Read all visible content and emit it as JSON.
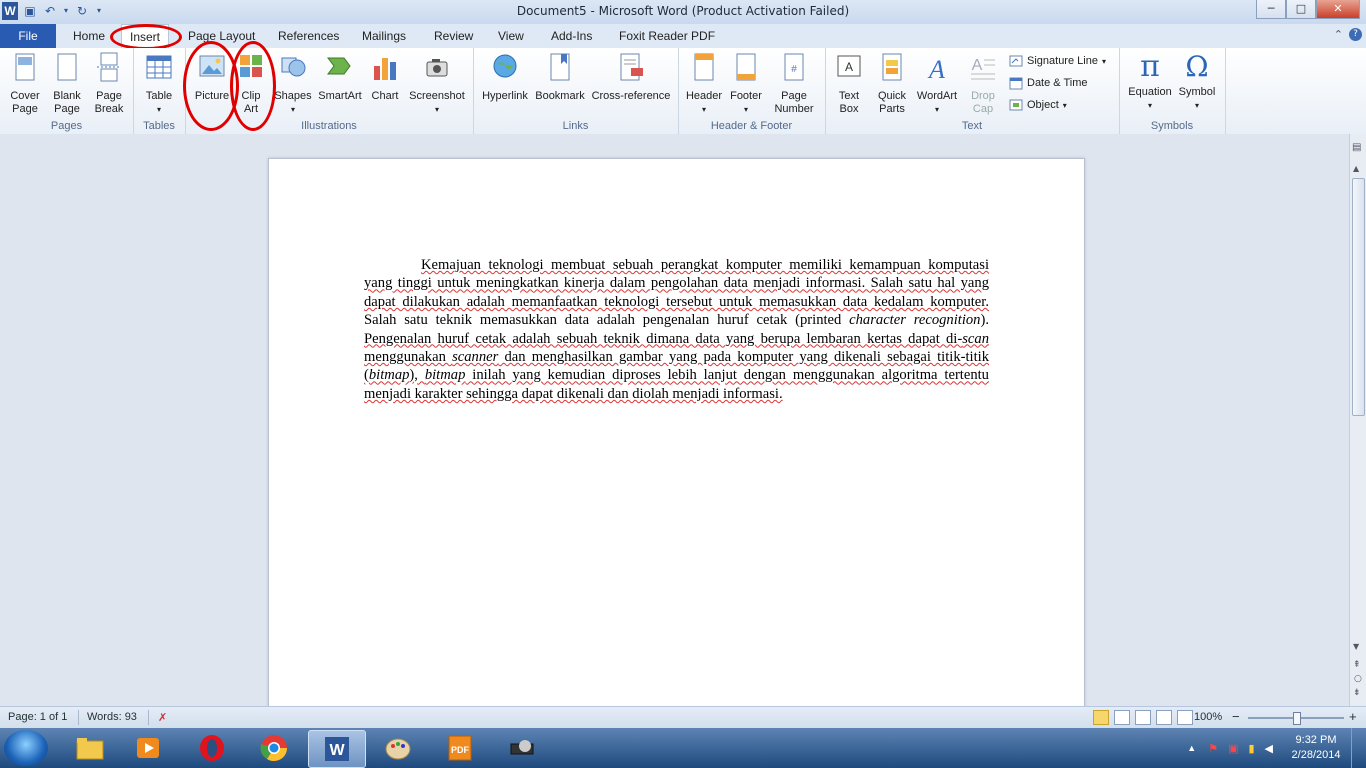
{
  "window": {
    "title": "Document5  -  Microsoft Word (Product Activation Failed)",
    "controls": {
      "minimize": "─",
      "maximize": "□",
      "close": "✕"
    }
  },
  "tabs": {
    "file": "File",
    "items": [
      "Home",
      "Insert",
      "Page Layout",
      "References",
      "Mailings",
      "Review",
      "View",
      "Add-Ins",
      "Foxit Reader PDF"
    ],
    "active": "Insert"
  },
  "ribbon": {
    "groups": {
      "pages": "Pages",
      "tables": "Tables",
      "illustrations": "Illustrations",
      "links": "Links",
      "header_footer": "Header & Footer",
      "text": "Text",
      "symbols": "Symbols"
    },
    "buttons": {
      "cover_page": [
        "Cover",
        "Page"
      ],
      "blank_page": [
        "Blank",
        "Page"
      ],
      "page_break": [
        "Page",
        "Break"
      ],
      "table": "Table",
      "picture": "Picture",
      "clip_art": [
        "Clip",
        "Art"
      ],
      "shapes": "Shapes",
      "smartart": "SmartArt",
      "chart": "Chart",
      "screenshot": "Screenshot",
      "hyperlink": "Hyperlink",
      "bookmark": "Bookmark",
      "cross_reference": "Cross-reference",
      "header": "Header",
      "footer": "Footer",
      "page_number": [
        "Page",
        "Number"
      ],
      "text_box": [
        "Text",
        "Box"
      ],
      "quick_parts": [
        "Quick",
        "Parts"
      ],
      "wordart": "WordArt",
      "drop_cap": [
        "Drop",
        "Cap"
      ],
      "signature_line": "Signature Line",
      "date_time": "Date & Time",
      "object": "Object",
      "equation": "Equation",
      "symbol": "Symbol"
    },
    "symbol_glyphs": {
      "equation": "π",
      "symbol": "Ω"
    }
  },
  "document": {
    "paragraph_runs": [
      {
        "t": "Kemajuan teknologi membuat sebuah perangkat komputer memiliki kemampuan komputasi yang tinggi untuk meningkatkan kinerja dalam pengolahan data menjadi informasi. Salah satu hal yang dapat dilakukan adalah memanfaatkan teknologi tersebut untuk memasukkan data kedalam komputer.",
        "s": "u"
      },
      {
        "t": " Salah satu teknik memasukkan data adalah pengenalan huruf cetak (printed ",
        "s": ""
      },
      {
        "t": "character recognition",
        "s": "i"
      },
      {
        "t": ").",
        "s": ""
      },
      {
        "t": " Pengenalan huruf cetak adalah sebuah teknik dimana data yang berupa lembaran kertas dapat di-",
        "s": "u"
      },
      {
        "t": "scan",
        "s": "ui"
      },
      {
        "t": " menggunakan ",
        "s": "u"
      },
      {
        "t": "scanner",
        "s": "ui"
      },
      {
        "t": " dan menghasilkan gambar yang pada komputer yang dikenali sebagai titik-titik (",
        "s": "u"
      },
      {
        "t": "bitmap",
        "s": "ui"
      },
      {
        "t": "), ",
        "s": "u"
      },
      {
        "t": "bitmap",
        "s": "ui"
      },
      {
        "t": " inilah yang kemudian diproses lebih lanjut dengan menggunakan algoritma tertentu menjadi karakter sehingga dapat dikenali dan diolah menjadi informasi.",
        "s": "u"
      }
    ]
  },
  "statusbar": {
    "page": "Page: 1 of 1",
    "words": "Words: 93",
    "zoom": "100%",
    "zoom_minus": "−",
    "zoom_plus": "+"
  },
  "taskbar": {
    "time": "9:32 PM",
    "date": "2/28/2014"
  },
  "annotations_color": "#e00000"
}
